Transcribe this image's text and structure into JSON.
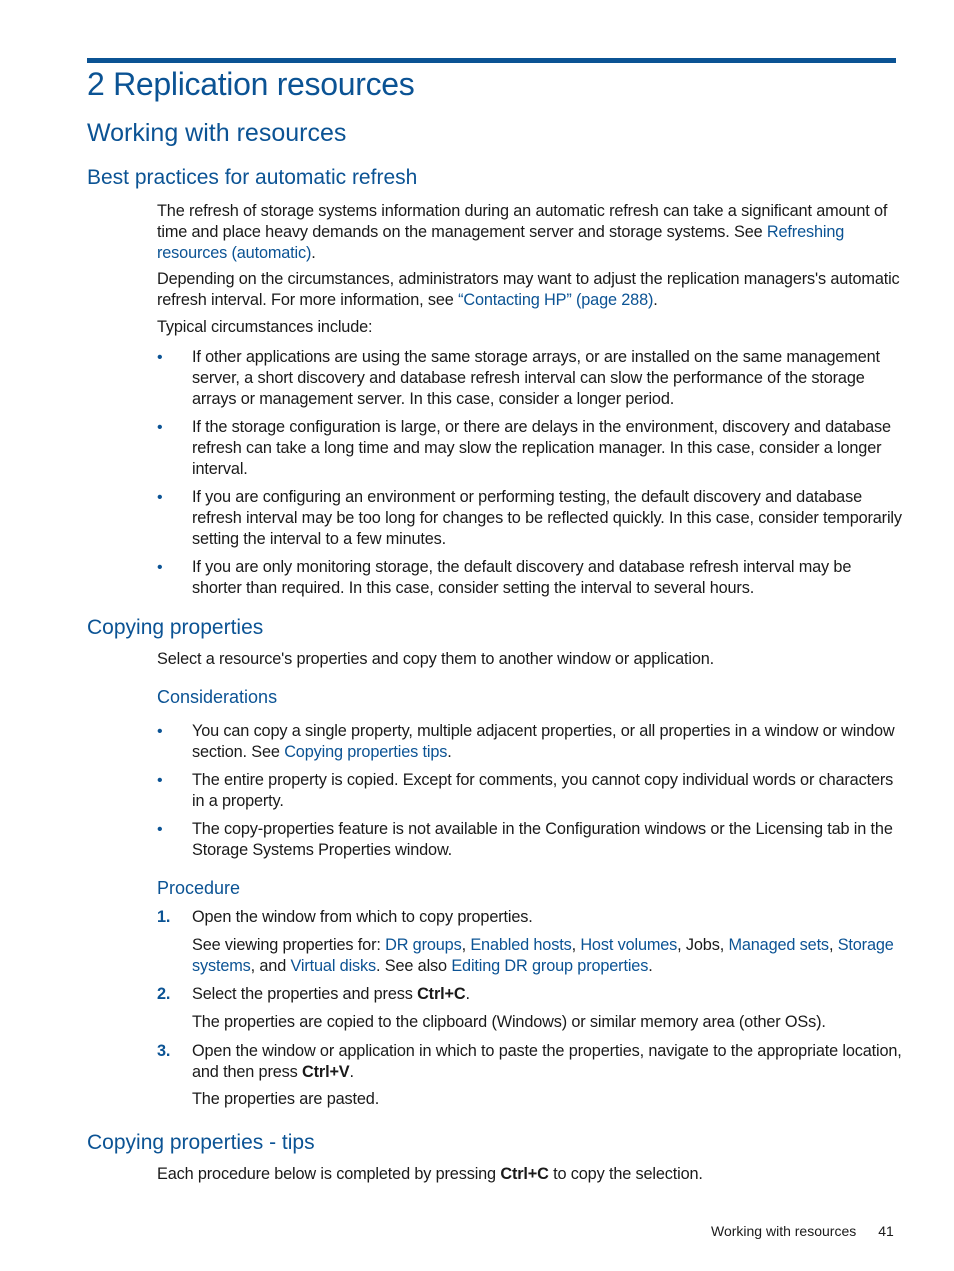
{
  "chapter_title": "2 Replication resources",
  "section_title": "Working with resources",
  "best_practices": {
    "title": "Best practices for automatic refresh",
    "para1_text": "The refresh of storage systems information during an automatic refresh can take a significant amount of time and place heavy demands on the management server and storage systems. See ",
    "para1_link": "Refreshing resources (automatic)",
    "para1_end": ".",
    "para2_text": "Depending on the circumstances, administrators may want to adjust the replication managers's automatic refresh interval. For more information, see ",
    "para2_link": "“Contacting HP” (page 288)",
    "para2_end": ".",
    "para3": "Typical circumstances include:",
    "bullets": [
      "If other applications are using the same storage arrays, or are installed on the same management server, a short discovery and database refresh interval can slow the performance of the storage arrays or management server. In this case, consider a longer period.",
      "If the storage configuration is large, or there are delays in the environment, discovery and database refresh can take a long time and may slow the replication manager. In this case, consider a longer interval.",
      "If you are configuring an environment or performing testing, the default discovery and database refresh interval may be too long for changes to be reflected quickly. In this case, consider temporarily setting the interval to a few minutes.",
      "If you are only monitoring storage, the default discovery and database refresh interval may be shorter than required. In this case, consider setting the interval to several hours."
    ]
  },
  "copying": {
    "title": "Copying properties",
    "intro": "Select a resource's properties and copy them to another window or application.",
    "considerations_title": "Considerations",
    "cons1_text": "You can copy a single property, multiple adjacent properties, or all properties in a window or window section. See ",
    "cons1_link": "Copying properties tips",
    "cons1_end": ".",
    "cons2": "The entire property is copied. Except for comments, you cannot copy individual words or characters in a property.",
    "cons3": "The copy-properties feature is not available in the Configuration windows or the Licensing tab in the Storage Systems Properties window.",
    "procedure_title": "Procedure",
    "steps": {
      "s1_num": "1.",
      "s1_text": "Open the window from which to copy properties.",
      "s1_sub_prefix": "See viewing properties for: ",
      "s1_links": [
        "DR groups",
        "Enabled hosts",
        "Host volumes",
        "Managed sets",
        "Storage systems",
        "Virtual disks",
        "Editing DR group properties"
      ],
      "s1_jobs": "Jobs",
      "s1_and": "and",
      "s1_see_also": "See also",
      "s2_num": "2.",
      "s2_text": "Select the properties and press ",
      "s2_key": "Ctrl+C",
      "s2_sub": "The properties are copied to the clipboard (Windows) or similar memory area (other OSs).",
      "s3_num": "3.",
      "s3_text": "Open the window or application in which to paste the properties, navigate to the appropriate location, and then press ",
      "s3_key": "Ctrl+V",
      "s3_sub": "The properties are pasted."
    }
  },
  "tips": {
    "title": "Copying properties - tips",
    "text_before": "Each procedure below is completed by pressing ",
    "key": "Ctrl+C",
    "text_after": " to copy the selection."
  },
  "footer": {
    "section": "Working with resources",
    "page": "41"
  }
}
